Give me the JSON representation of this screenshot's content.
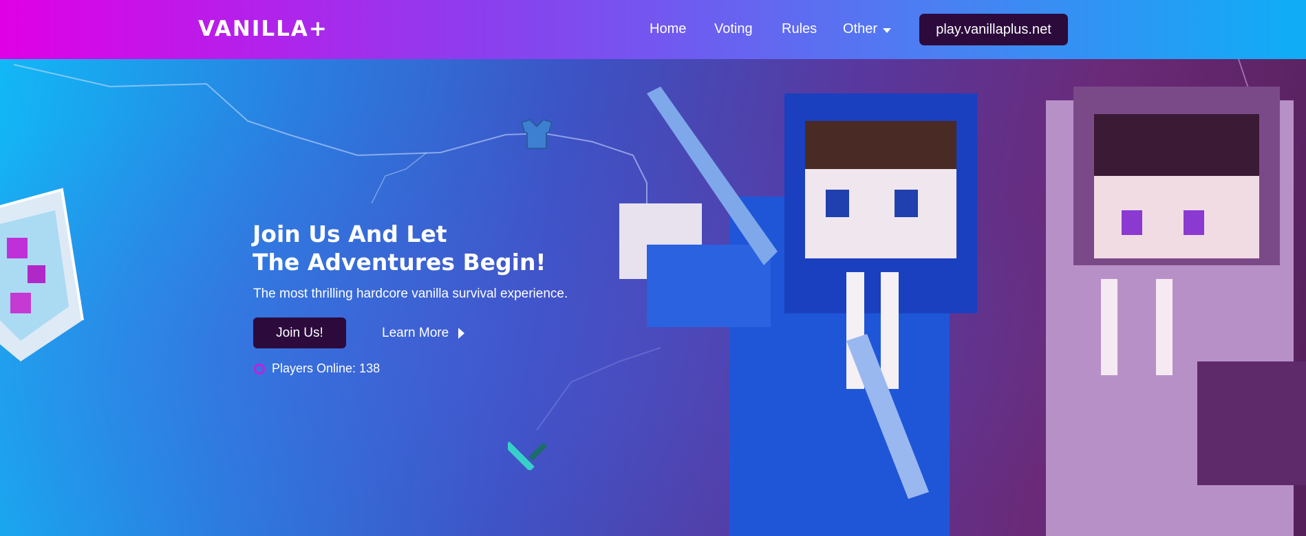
{
  "brand": {
    "logo_text": "VANILLA+"
  },
  "nav": {
    "items": [
      {
        "label": "Home"
      },
      {
        "label": "Voting"
      },
      {
        "label": "Rules"
      },
      {
        "label": "Other"
      }
    ],
    "server_ip": "play.vanillaplus.net"
  },
  "hero": {
    "headline_line1": "Join Us And Let",
    "headline_line2": "The Adventures Begin!",
    "subtitle": "The most thrilling hardcore vanilla survival experience.",
    "primary_button": "Join Us!",
    "secondary_button": "Learn More",
    "players_online": "Players Online: 138"
  },
  "icons": {
    "other_dropdown": "chevron-down-icon",
    "learn_more": "play-arrow-icon",
    "online_status": "status-dot-icon"
  },
  "colors": {
    "nav_gradient_start": "#e000e6",
    "nav_gradient_end": "#0eaef6",
    "button_bg": "#2c0a3c",
    "status_dot": "#c21fe0"
  }
}
